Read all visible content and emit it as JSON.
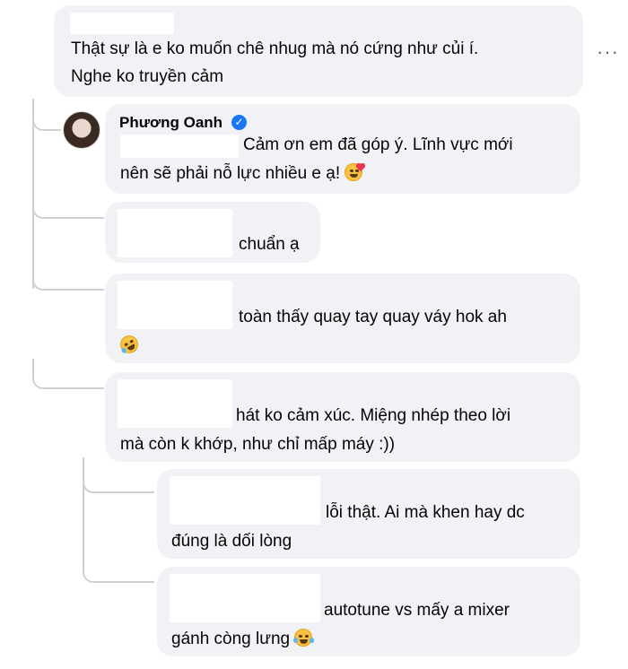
{
  "comments": [
    {
      "line1": "Thật sự là e ko muốn chê nhug mà nó cứng như củi í.",
      "line2": "Nghe ko truyền cảm"
    },
    {
      "author": "Phương Oanh",
      "line1": "Cảm ơn em đã góp ý. Lĩnh vực mới",
      "line2": "nên sẽ phải nỗ lực nhiều e ạ!",
      "emoji": "smiling-face-with-hearts"
    },
    {
      "line1": "chuẩn ạ"
    },
    {
      "line1": "toàn thấy quay tay quay váy hok ah",
      "emoji": "rolling-on-floor-laughing"
    },
    {
      "line1": "hát ko cảm xúc. Miệng nhép theo lời",
      "line2": "mà còn k khớp, như chỉ mấp máy :))"
    },
    {
      "line1": "lỗi thật. Ai mà khen hay dc",
      "line2": "đúng là dối lòng"
    },
    {
      "line1": "autotune vs mấy a mixer",
      "line2": "gánh còng lưng",
      "emoji": "face-with-tears-of-joy"
    }
  ],
  "more_label": "···",
  "verified_mark": "✓",
  "colors": {
    "bubble": "#f0f2f5",
    "thread": "#ced0d4",
    "verified": "#1877f2",
    "text": "#050505"
  }
}
